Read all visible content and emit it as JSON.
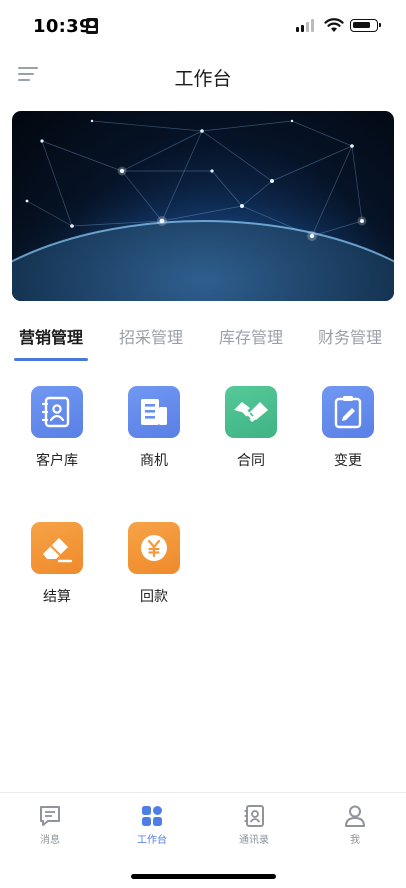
{
  "status_bar": {
    "time": "10:39",
    "icons": [
      "id-card-icon",
      "cellular-signal-icon",
      "wifi-icon",
      "battery-icon"
    ]
  },
  "nav": {
    "title": "工作台",
    "left_icon": "menu-icon"
  },
  "banner": {
    "image": "earth-network-banner"
  },
  "tabs": [
    {
      "label": "营销管理",
      "active": true
    },
    {
      "label": "招采管理",
      "active": false
    },
    {
      "label": "库存管理",
      "active": false
    },
    {
      "label": "财务管理",
      "active": false
    }
  ],
  "apps": [
    {
      "label": "客户库",
      "icon": "contact-book-icon",
      "color": "#6a90ef"
    },
    {
      "label": "商机",
      "icon": "building-icon",
      "color": "#6a90ef"
    },
    {
      "label": "合同",
      "icon": "handshake-icon",
      "color": "#4cbf90"
    },
    {
      "label": "变更",
      "icon": "edit-document-icon",
      "color": "#6a90ef"
    },
    {
      "label": "结算",
      "icon": "eraser-icon",
      "color": "#f39a3c"
    },
    {
      "label": "回款",
      "icon": "yen-coin-icon",
      "color": "#f39a3c"
    }
  ],
  "tab_bar": [
    {
      "label": "消息",
      "icon": "message-icon",
      "active": false
    },
    {
      "label": "工作台",
      "icon": "grid-icon",
      "active": true
    },
    {
      "label": "通讯录",
      "icon": "contacts-icon",
      "active": false
    },
    {
      "label": "我",
      "icon": "user-icon",
      "active": false
    }
  ],
  "colors": {
    "accent": "#4a78d8",
    "tab_inactive": "#9aa0a8",
    "tabbar_inactive": "#8e939c"
  }
}
